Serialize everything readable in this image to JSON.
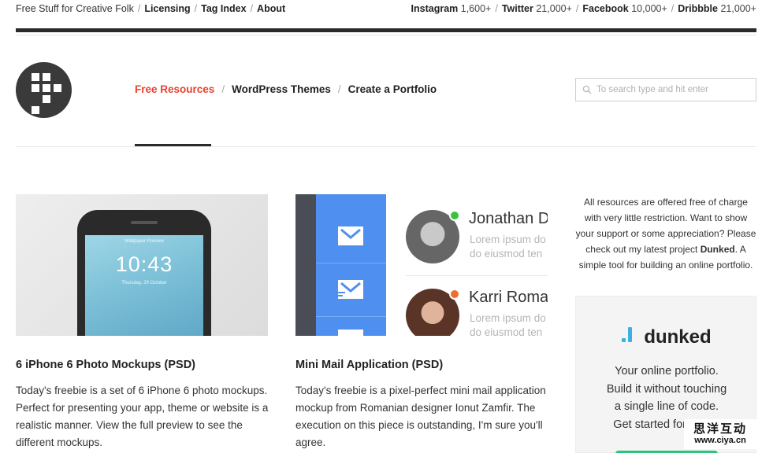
{
  "topbar": {
    "tagline": "Free Stuff for Creative Folk",
    "links": [
      "Licensing",
      "Tag Index",
      "About"
    ],
    "social": [
      {
        "name": "Instagram",
        "count": "1,600+"
      },
      {
        "name": "Twitter",
        "count": "21,000+"
      },
      {
        "name": "Facebook",
        "count": "10,000+"
      },
      {
        "name": "Dribbble",
        "count": "21,000+"
      }
    ]
  },
  "nav": {
    "items": [
      "Free Resources",
      "WordPress Themes",
      "Create a Portfolio"
    ],
    "active_index": 0
  },
  "search": {
    "placeholder": "To search type and hit enter",
    "icon": "search-icon"
  },
  "colors": {
    "accent": "#e8412c",
    "dark": "#2b2b2b",
    "mail_blue": "#4f8ff0",
    "online_green": "#3bc43b",
    "away_orange": "#f26d2a",
    "dunked_blue": "#3bb0e2"
  },
  "posts": [
    {
      "title": "6 iPhone 6 Photo Mockups (PSD)",
      "excerpt": "Today's freebie is a set of 6 iPhone 6 photo mockups. Perfect for presenting your app, theme or website is a realistic manner. View the full preview to see the different mockups.",
      "image": {
        "label": "Wallpaper Preview",
        "time": "10:43",
        "date": "Thursday, 29 October"
      }
    },
    {
      "title": "Mini Mail Application (PSD)",
      "excerpt": "Today's freebie is a pixel-perfect mini mail application mockup from Romanian designer Ionut Zamfir. The execution on this piece is outstanding, I'm sure you'll agree.",
      "image": {
        "contacts": [
          {
            "name": "Jonathan D",
            "line1": "Lorem ipsum do",
            "line2": "do eiusmod ten"
          },
          {
            "name": "Karri Roman",
            "line1": "Lorem ipsum do",
            "line2": "do eiusmod ten"
          }
        ]
      }
    }
  ],
  "sidebar": {
    "text_before": "All resources are offered free of charge with very little restriction. Want to show your support or some appreciation? Please check out my latest project ",
    "project": "Dunked",
    "text_after": ". A simple tool for building an online portfolio."
  },
  "ad": {
    "brand": "dunked",
    "lines": [
      "Your online portfolio.",
      "Build it without touching",
      "a single line of code.",
      "Get started for FREE"
    ]
  },
  "watermark": {
    "cn": "思洋互动",
    "url": "www.ciya.cn"
  }
}
